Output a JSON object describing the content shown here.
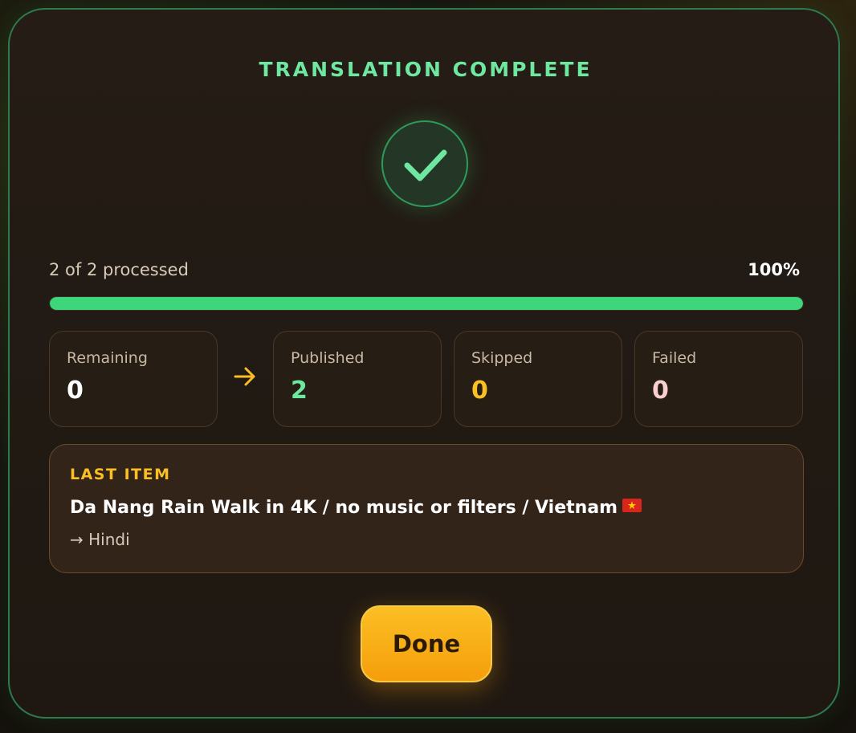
{
  "modal": {
    "title": "TRANSLATION COMPLETE",
    "status_icon": "checkmark-icon"
  },
  "progress": {
    "processed_text": "2 of 2 processed",
    "percent_text": "100%",
    "fraction": 1.0
  },
  "stats": [
    {
      "label": "Remaining",
      "value": "0",
      "color": "#ffffff"
    },
    {
      "label": "Published",
      "value": "2",
      "color": "#6ee7a0"
    },
    {
      "label": "Skipped",
      "value": "0",
      "color": "#fbbf24"
    },
    {
      "label": "Failed",
      "value": "0",
      "color": "#fbcfd2"
    }
  ],
  "flow_icon": "arrow-right-icon",
  "last_item": {
    "heading": "LAST ITEM",
    "title": "Da Nang Rain Walk in 4K / no music or filters / Vietnam",
    "flag_icon": "vietnam-flag-icon",
    "target": "→ Hindi"
  },
  "actions": {
    "done_label": "Done"
  },
  "colors": {
    "accent_green": "#3ed67a",
    "accent_amber": "#fbbf24"
  }
}
